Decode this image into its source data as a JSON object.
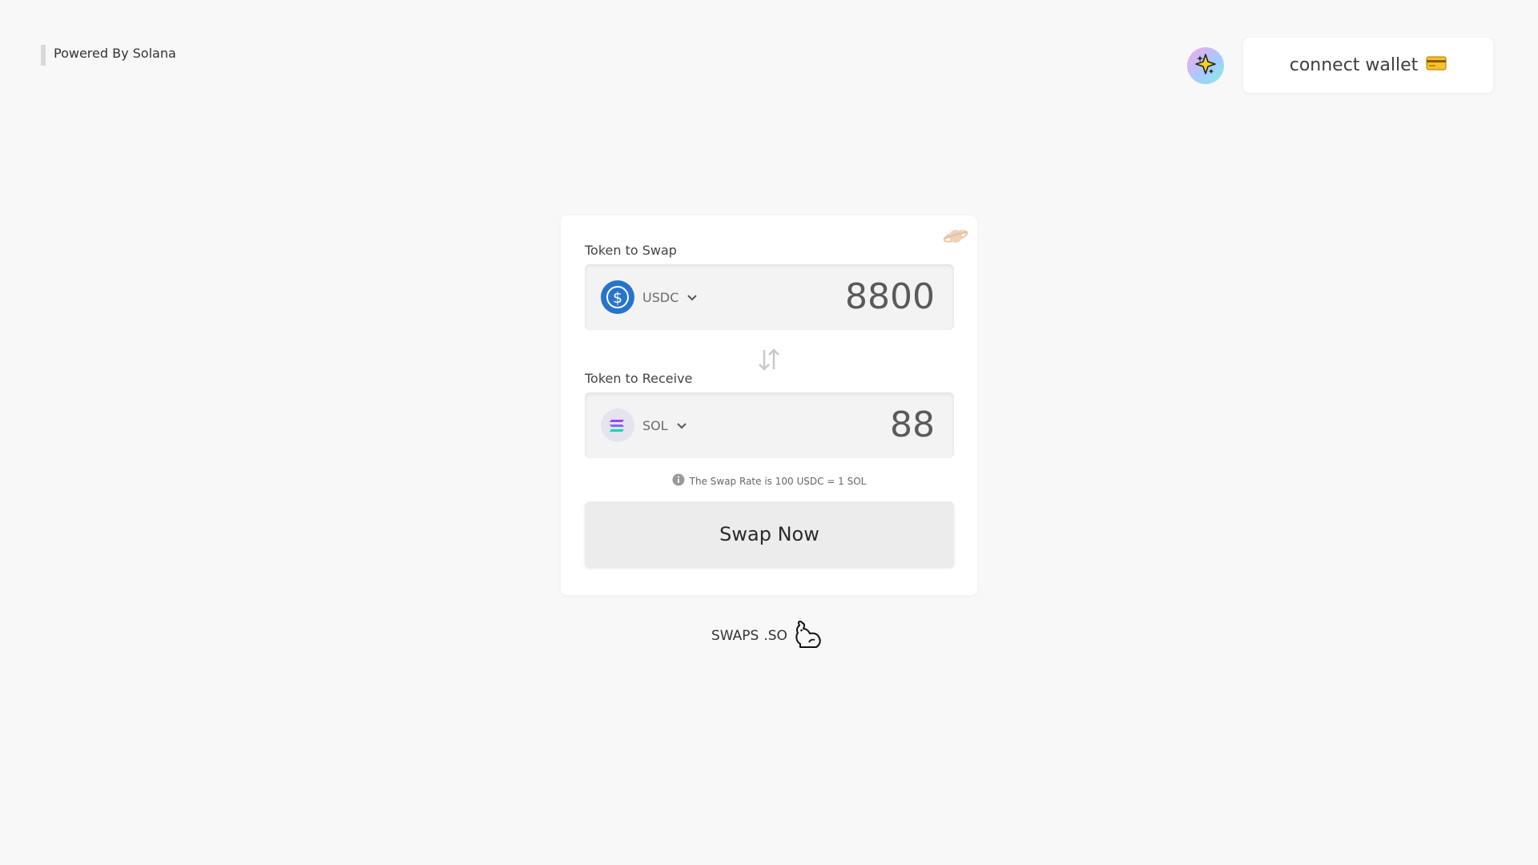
{
  "header": {
    "powered_by": "Powered By Solana",
    "sparkle_icon": "sparkle-icon",
    "wallet_button_label": "connect wallet",
    "wallet_icon": "credit-card-icon"
  },
  "swap": {
    "from_label": "Token to Swap",
    "from_token": "USDC",
    "from_amount": "8800",
    "to_label": "Token to Receive",
    "to_token": "SOL",
    "to_amount": "88",
    "rate_text": "The Swap Rate is 100 USDC = 1 SOL",
    "swap_button_label": "Swap Now"
  },
  "footer": {
    "brand_name": "SWAPS",
    "brand_suffix": ".SO"
  },
  "colors": {
    "background": "#f8f8f8",
    "usdc": "#2775ca",
    "button": "#ececec"
  }
}
